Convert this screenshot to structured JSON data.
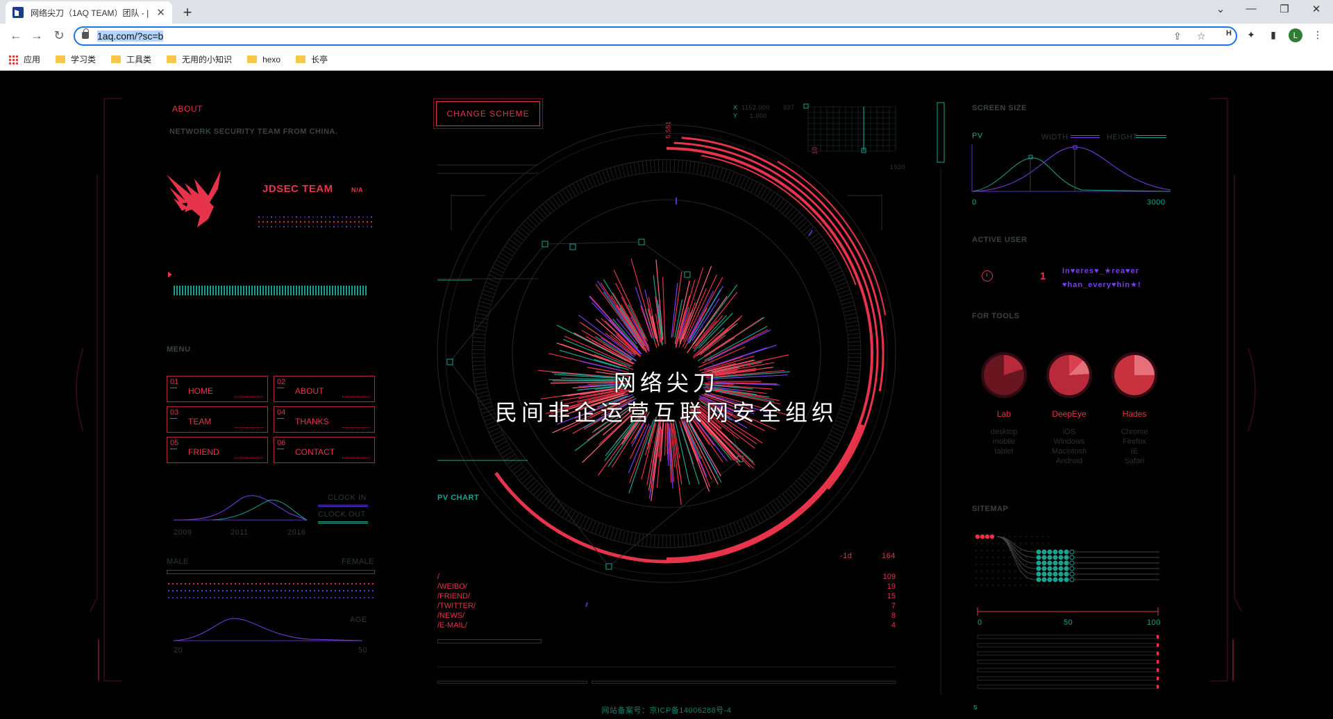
{
  "browser": {
    "tab_title": "网络尖刀（1AQ TEAM）团队 - |",
    "url": "1aq.com/?sc=b",
    "profile_initial": "L",
    "bookmarks": [
      "应用",
      "学习类",
      "工具类",
      "无用的小知识",
      "hexo",
      "长亭"
    ]
  },
  "left": {
    "about_heading": "ABOUT",
    "about_text": "NETWORK SECURITY TEAM FROM CHINA.",
    "team_name": "JDSEC TEAM",
    "team_badge": "N/A",
    "menu_heading": "MENU",
    "menu": [
      {
        "num": "01",
        "label": "HOME"
      },
      {
        "num": "02",
        "label": "ABOUT"
      },
      {
        "num": "03",
        "label": "TEAM"
      },
      {
        "num": "04",
        "label": "THANKS"
      },
      {
        "num": "05",
        "label": "FRIEND"
      },
      {
        "num": "06",
        "label": "CONTACT"
      }
    ],
    "clock_in": "CLOCK IN",
    "clock_out": "CLOCK OUT",
    "years": [
      "2009",
      "2011",
      "2016"
    ],
    "male": "MALE",
    "female": "FEMALE",
    "age": "AGE",
    "age_min": "20",
    "age_max": "50"
  },
  "center": {
    "change_scheme": "CHANGE SCHEME",
    "title_line1": "网络尖刀",
    "title_line2": "民间非企运营互联网安全组织",
    "top_value": "5.551",
    "right_value": "10",
    "coord_x_label": "X",
    "coord_y_label": "Y",
    "coord_x": "1152.000",
    "coord_y": "1.000",
    "coord_extra": "937",
    "coord_max": "1920",
    "pv_chart": "PV CHART",
    "pv_range": "-1d",
    "pv_total": "164",
    "paths": [
      {
        "path": "/",
        "count": "109"
      },
      {
        "path": "/WEIBO/",
        "count": "19"
      },
      {
        "path": "/FRIEND/",
        "count": "15"
      },
      {
        "path": "/TWITTER/",
        "count": "7"
      },
      {
        "path": "/NEWS/",
        "count": "8"
      },
      {
        "path": "/E-MAIL/",
        "count": "4"
      }
    ],
    "footer": "网站备案号：京ICP备14006288号-4"
  },
  "right": {
    "screen_size": "SCREEN SIZE",
    "pv": "PV",
    "width": "WIDTH",
    "height": "HEIGHT",
    "axis_min": "0",
    "axis_max": "3000",
    "active_user": "ACTIVE USER",
    "active_count": "1",
    "marquee_line1": "In♥eres♥_★rea♥er",
    "marquee_line2": "♥han_every♥hin★!",
    "for_tools": "FOR TOOLS",
    "tools": [
      {
        "name": "Lab",
        "os": [
          "desktop",
          "mobile",
          "tablet"
        ]
      },
      {
        "name": "DeepEye",
        "os": [
          "iOS",
          "Windows",
          "Macintosh",
          "Android"
        ]
      },
      {
        "name": "Hades",
        "os": [
          "Chrome",
          "Firefox",
          "IE",
          "Safari"
        ]
      }
    ],
    "sitemap": "SITEMAP",
    "scale": [
      "0",
      "50",
      "100"
    ],
    "bottom_letter": "s"
  },
  "colors": {
    "accent_red": "#e8344a",
    "accent_teal": "#1aa38f",
    "accent_purple": "#7a3cf0"
  }
}
